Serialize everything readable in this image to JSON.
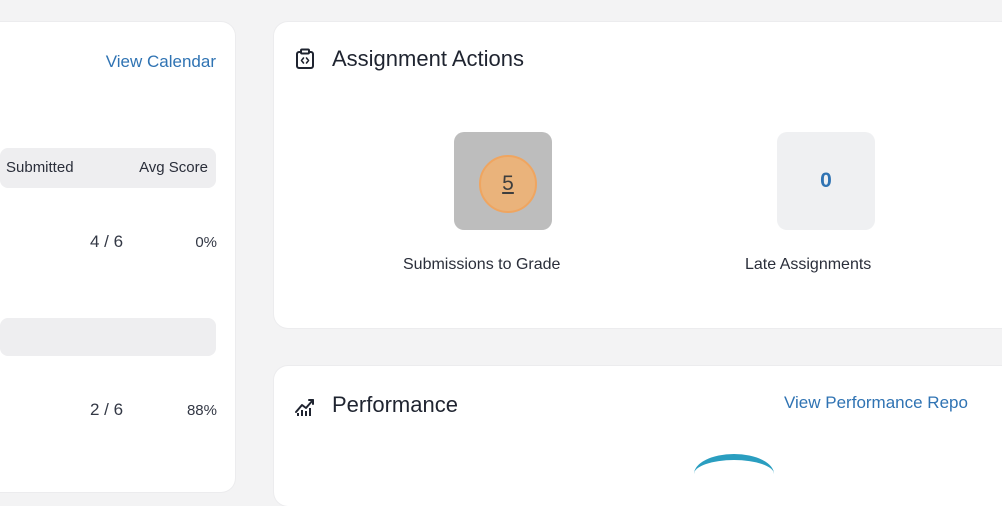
{
  "calendar": {
    "view_calendar_label": "View Calendar",
    "columns": [
      "Submitted",
      "Avg Score"
    ],
    "rows": [
      {
        "submitted": "4 / 6",
        "avg_score": "0%"
      },
      {
        "submitted": "2 / 6",
        "avg_score": "88%"
      }
    ]
  },
  "actions": {
    "title": "Assignment Actions",
    "icon": "clipboard-code-icon",
    "tiles": [
      {
        "count": "5",
        "label": "Submissions to Grade"
      },
      {
        "count": "0",
        "label": "Late Assignments"
      }
    ]
  },
  "performance": {
    "title": "Performance",
    "icon": "chart-growth-icon",
    "view_report_label": "View Performance Repo"
  },
  "colors": {
    "link": "#2f73b3",
    "highlight": "#f2b270",
    "arc": "#2a9ec0"
  }
}
